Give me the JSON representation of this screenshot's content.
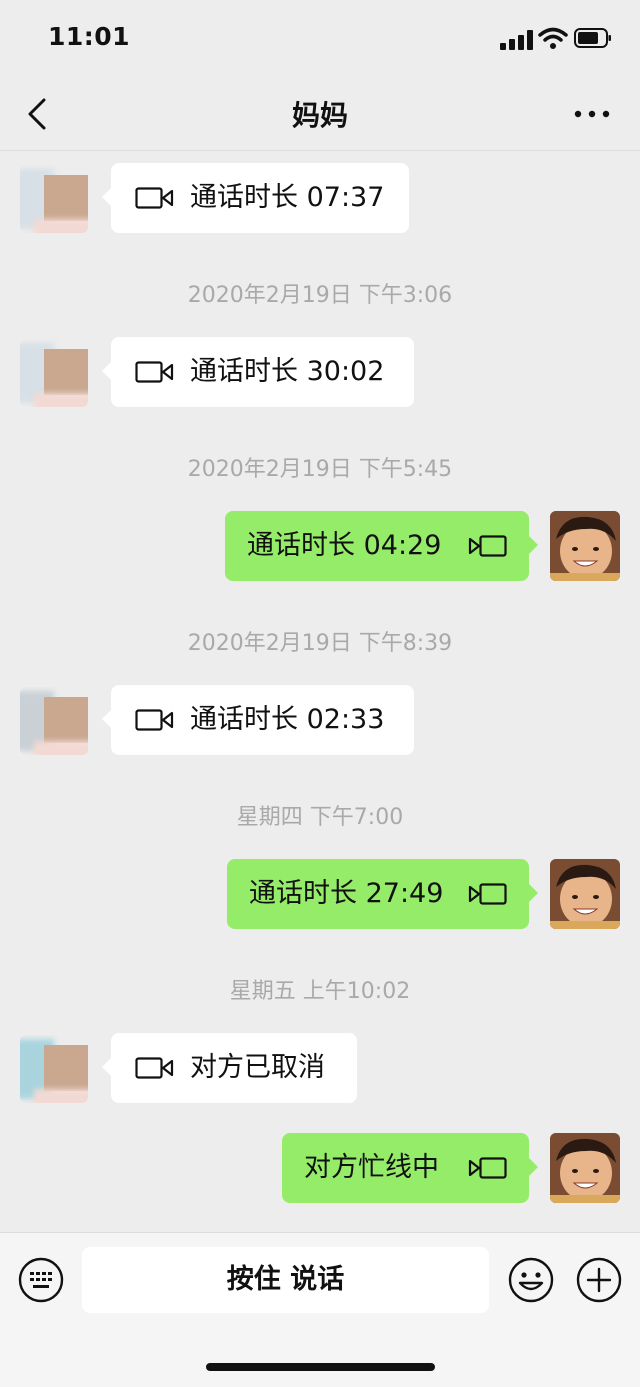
{
  "status": {
    "time": "11:01"
  },
  "header": {
    "title": "妈妈"
  },
  "messages": [
    {
      "text": "通话时长 07:37"
    },
    {
      "stamp": "2020年2月19日 下午3:06",
      "text": "通话时长 30:02"
    },
    {
      "stamp": "2020年2月19日 下午5:45",
      "text": "通话时长 04:29"
    },
    {
      "stamp": "2020年2月19日 下午8:39",
      "text": "通话时长 02:33"
    },
    {
      "stamp": "星期四 下午7:00",
      "text": "通话时长 27:49"
    },
    {
      "stamp": "星期五 上午10:02",
      "text": "对方已取消"
    },
    {
      "text": "对方忙线中"
    }
  ],
  "input": {
    "talk_label": "按住 说话"
  },
  "icons": {
    "back": "chevron-left-icon",
    "more": "more-dots-icon",
    "call": "video-call-icon",
    "keyboard": "keyboard-icon",
    "emoji": "emoji-icon",
    "plus": "plus-icon"
  },
  "colors": {
    "background": "#ededed",
    "incoming_bubble": "#ffffff",
    "outgoing_bubble": "#95ec69",
    "timestamp": "#a9a9a9"
  }
}
